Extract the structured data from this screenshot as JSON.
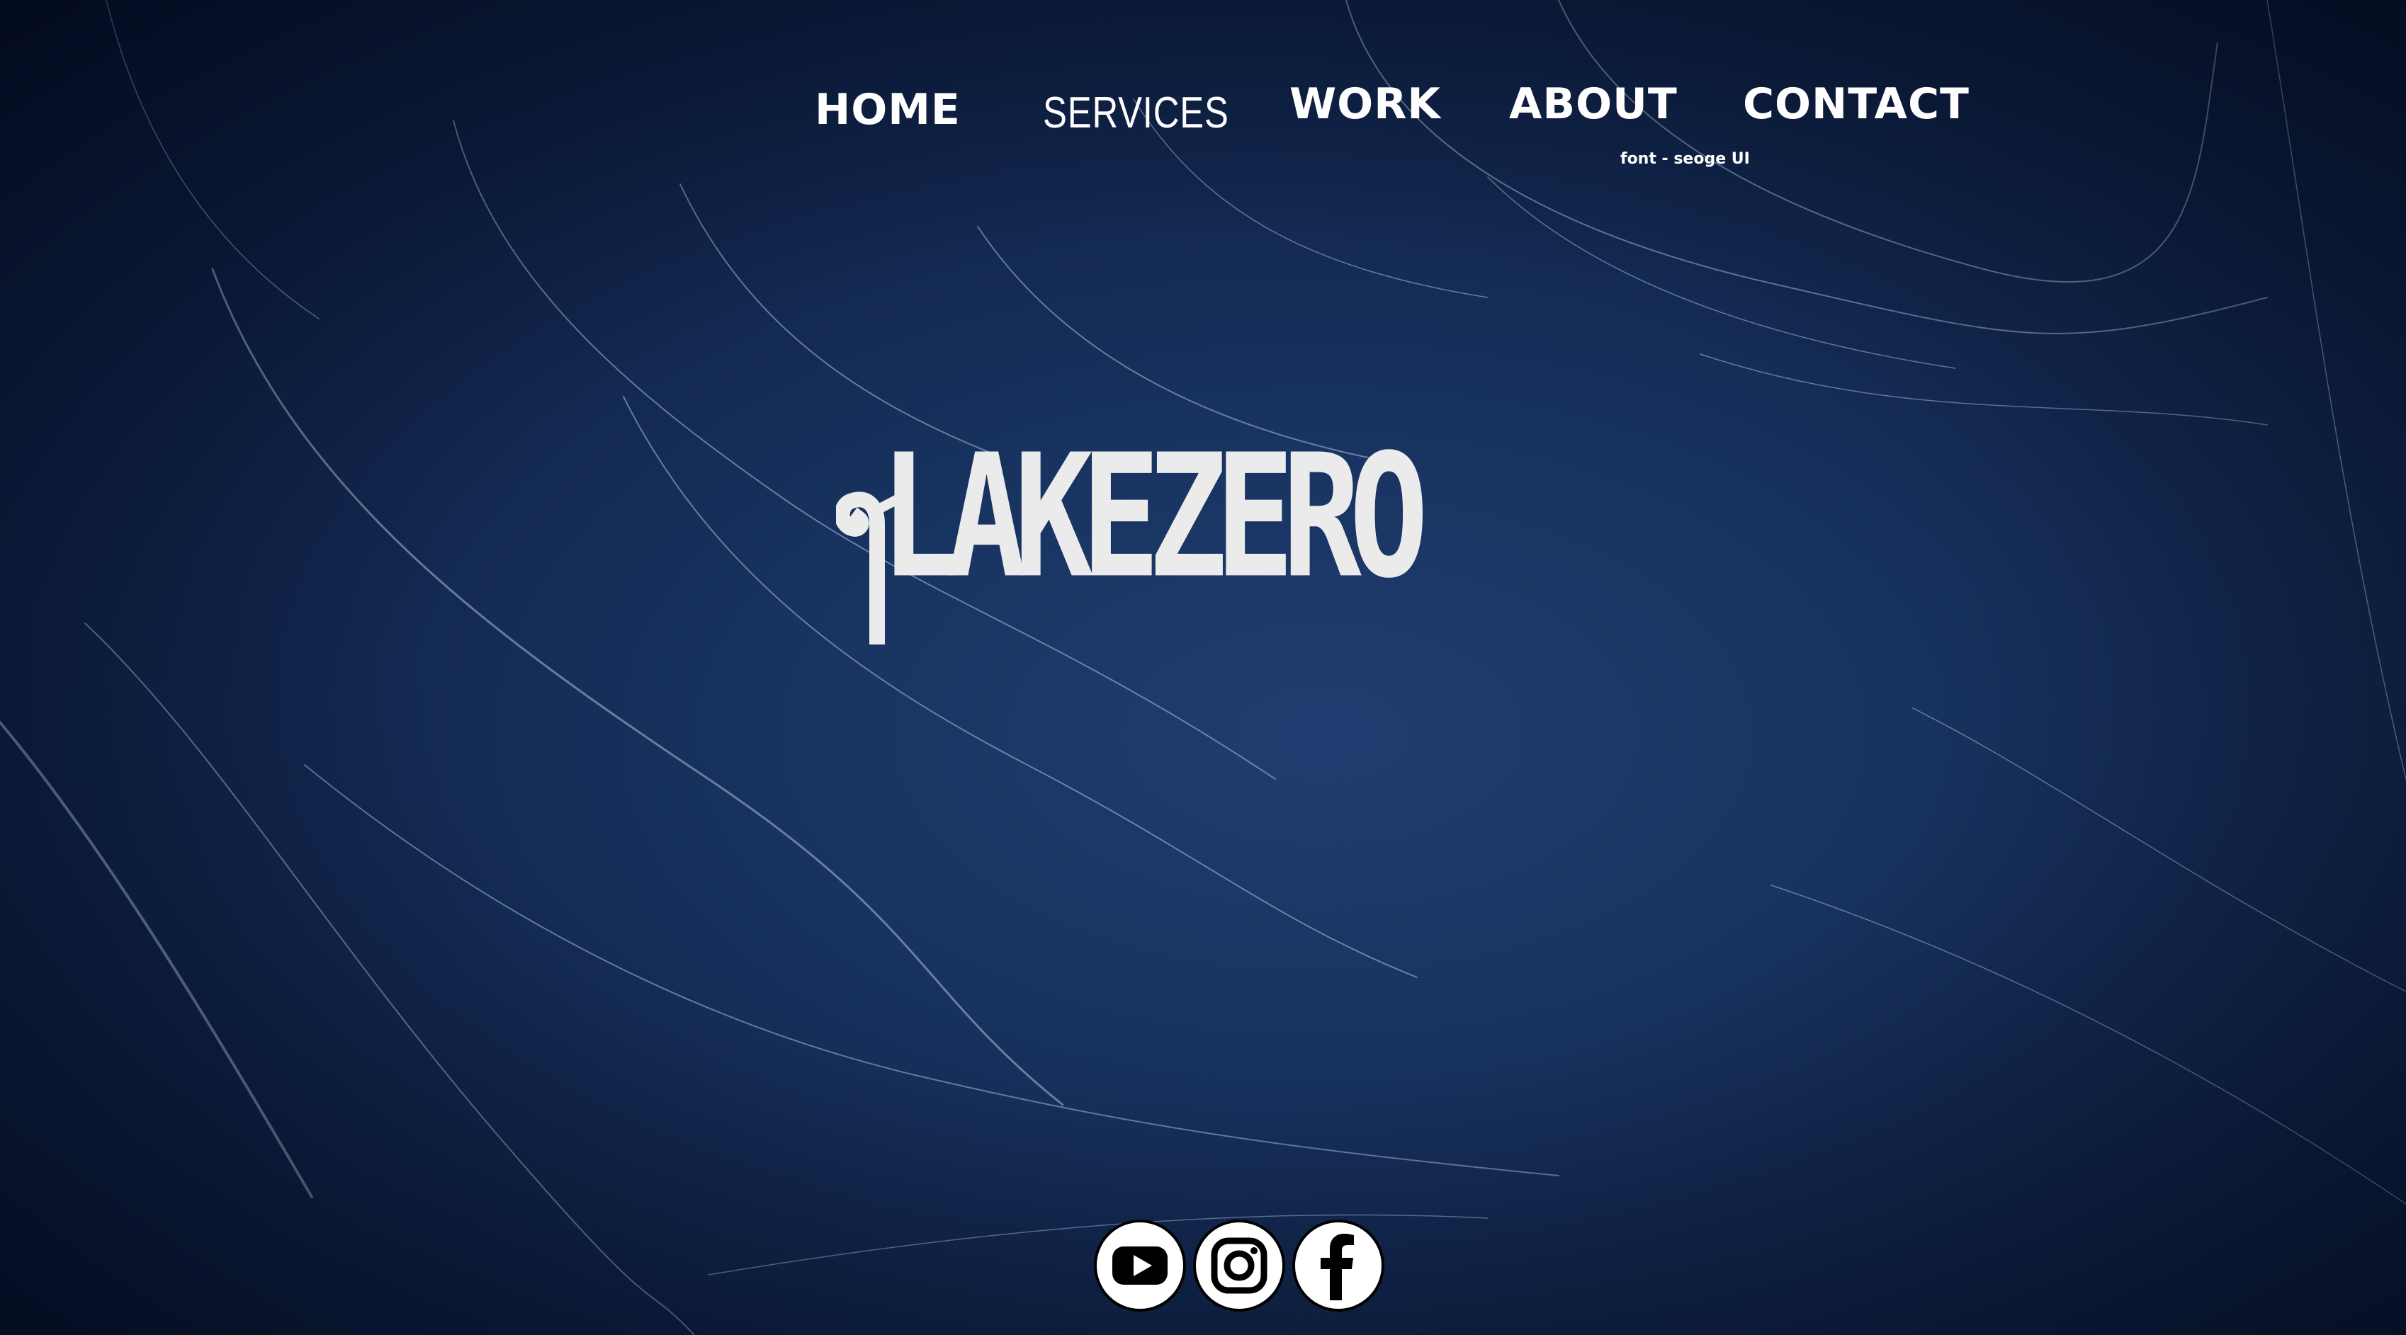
{
  "nav": {
    "home": "HOME",
    "services": "SERVICES",
    "work": "WORK",
    "about": "ABOUT",
    "contact": "CONTACT",
    "font_note": "font - seoge UI"
  },
  "hero": {
    "logo_text": "LAKEZERO"
  },
  "social": [
    {
      "name": "youtube",
      "icon": "youtube-icon"
    },
    {
      "name": "instagram",
      "icon": "instagram-icon"
    },
    {
      "name": "facebook",
      "icon": "facebook-icon"
    }
  ],
  "colors": {
    "background": "#10244a",
    "text": "#ffffff",
    "logo": "#ebebeb"
  }
}
